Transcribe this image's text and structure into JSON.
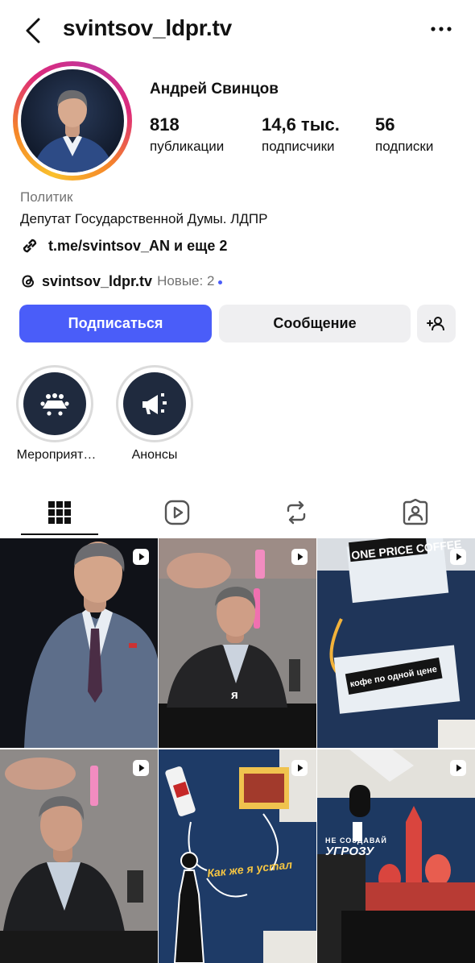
{
  "header": {
    "username": "svintsov_ldpr.tv",
    "back_icon": "chevron-left-icon",
    "more_icon": "more-horizontal-icon"
  },
  "profile": {
    "name": "Андрей Свинцов",
    "stats": [
      {
        "value": "818",
        "label": "публикации"
      },
      {
        "value": "14,6 тыс.",
        "label": "подписчики"
      },
      {
        "value": "56",
        "label": "подписки"
      }
    ],
    "category": "Политик",
    "bio": "Депутат Государственной Думы. ЛДПР",
    "link": "t.me/svintsov_AN и еще 2",
    "threads_handle": "svintsov_ldpr.tv",
    "threads_new": "Новые: 2",
    "story_ring_colors": [
      "#f9c02c",
      "#f58529",
      "#dd2a7b",
      "#c1359b"
    ]
  },
  "actions": {
    "follow_label": "Подписаться",
    "message_label": "Сообщение",
    "follow_color": "#4a5df9"
  },
  "highlights": [
    {
      "label": "Мероприят…",
      "icon": "conference-icon"
    },
    {
      "label": "Анонсы",
      "icon": "megaphone-icon"
    }
  ],
  "tabs": [
    {
      "name": "posts-grid",
      "icon": "grid-icon",
      "active": true
    },
    {
      "name": "reels",
      "icon": "reels-icon"
    },
    {
      "name": "reposts",
      "icon": "repost-icon"
    },
    {
      "name": "tagged",
      "icon": "tagged-person-icon"
    }
  ],
  "posts": [
    {
      "type": "reel",
      "caption": ""
    },
    {
      "type": "reel",
      "caption": "я"
    },
    {
      "type": "reel",
      "caption": "кофе по одной цене",
      "headline": "ONE PRICE COFFEE"
    },
    {
      "type": "reel",
      "caption": ""
    },
    {
      "type": "reel",
      "caption": "Как же я устал"
    },
    {
      "type": "reel",
      "caption": "УГРОЗУ",
      "headline": "НЕ СОЗДАВАЙ"
    }
  ]
}
